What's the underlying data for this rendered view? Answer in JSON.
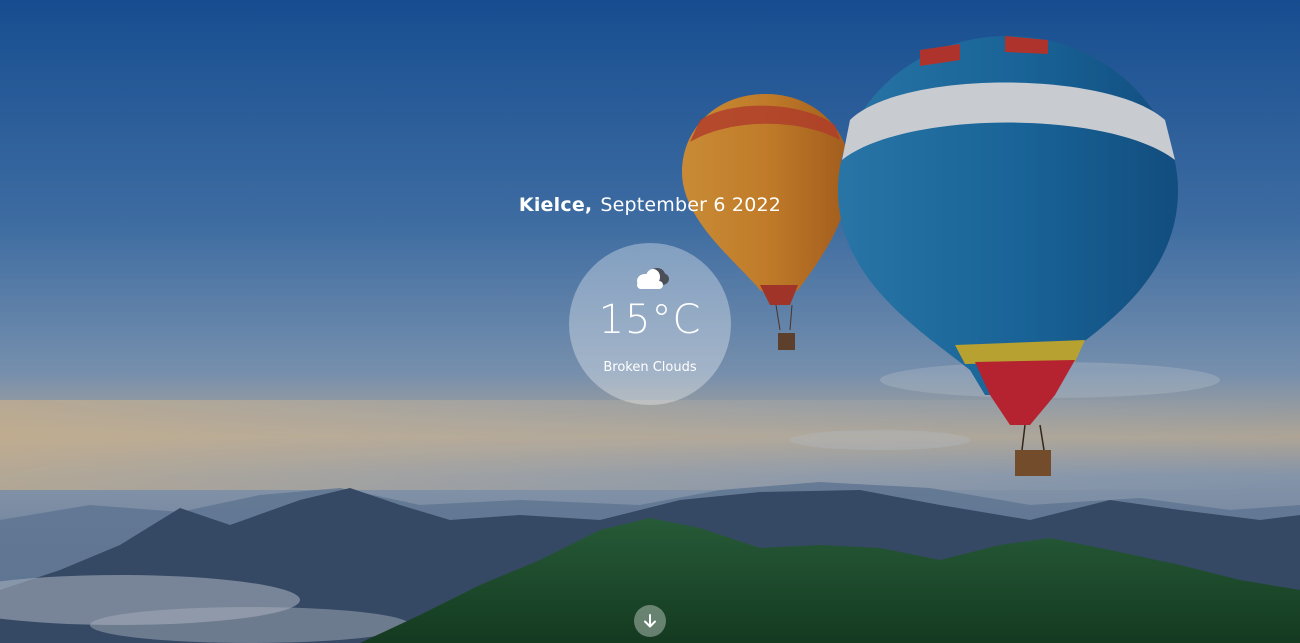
{
  "location": {
    "city": "Kielce,",
    "date": "September 6 2022"
  },
  "weather": {
    "temperature": "15°C",
    "description": "Broken Clouds",
    "icon": "broken-clouds-icon"
  },
  "navigation": {
    "scroll_icon": "arrow-down-icon"
  }
}
